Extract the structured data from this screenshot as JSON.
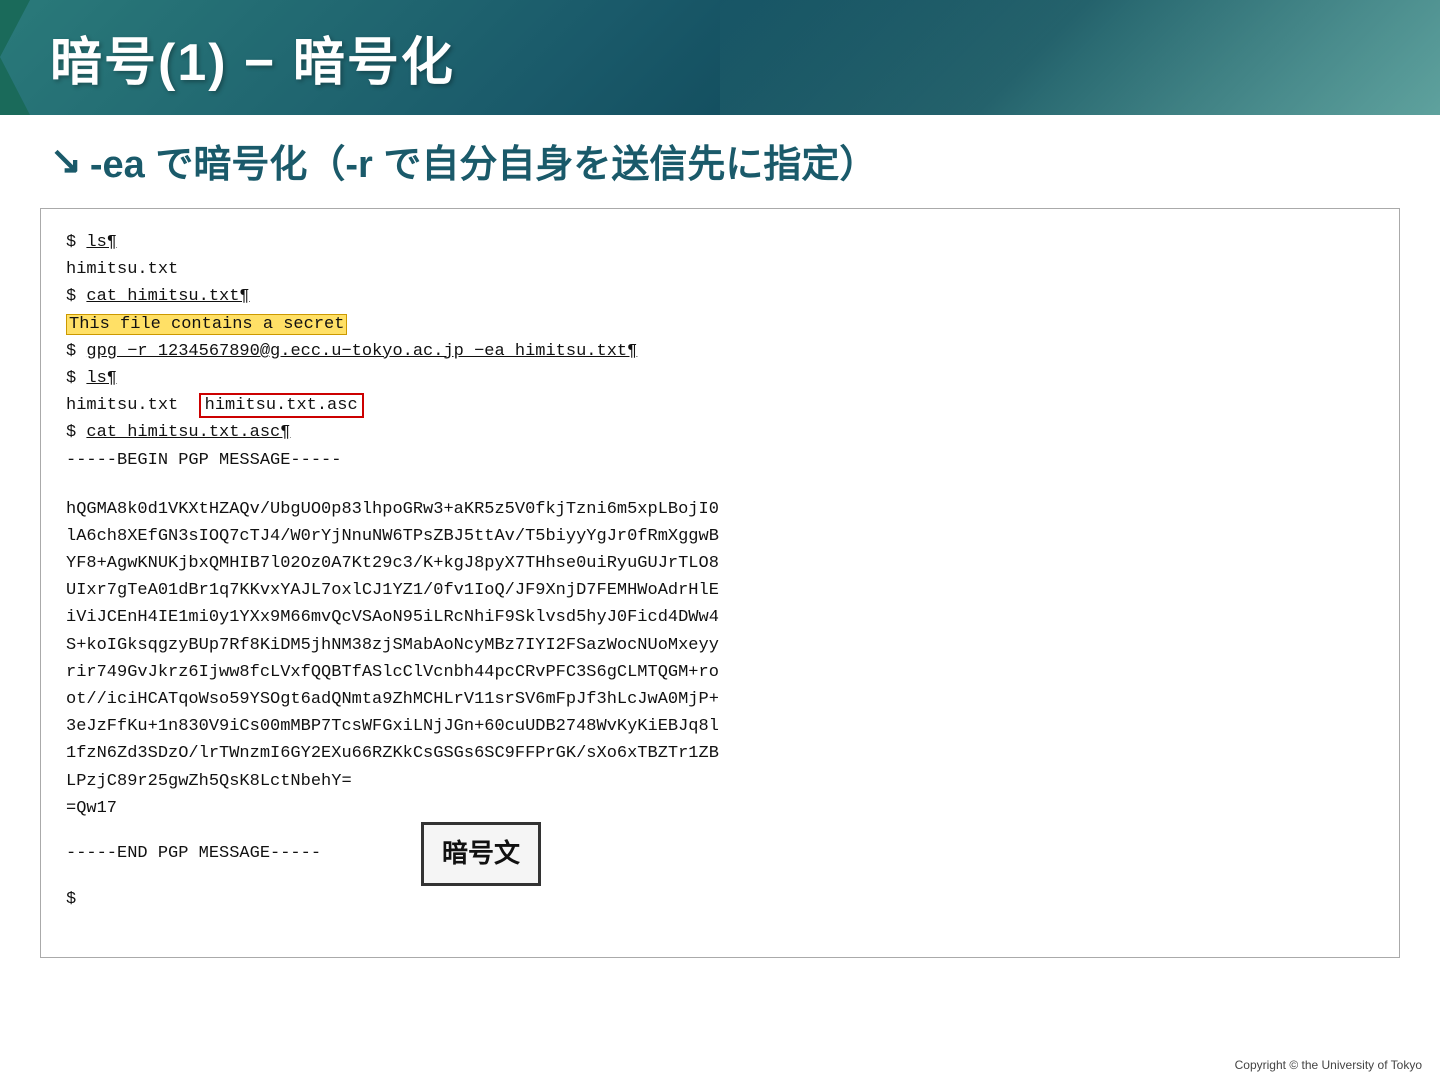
{
  "header": {
    "title": "暗号(1) − 暗号化"
  },
  "subtitle": {
    "arrow": "↘",
    "text": "-ea で暗号化（-r で自分自身を送信先に指定）"
  },
  "terminal": {
    "lines": [
      {
        "type": "prompt",
        "content": "$ ls¶"
      },
      {
        "type": "output",
        "content": "himitsu.txt"
      },
      {
        "type": "prompt-underline",
        "content": "$ cat himitsu.txt¶"
      },
      {
        "type": "output-highlight",
        "content": "This file contains a secret"
      },
      {
        "type": "prompt-underline",
        "content": "$ gpg −r 1234567890@g.ecc.u−tokyo.ac.jp −ea himitsu.txt¶"
      },
      {
        "type": "prompt",
        "content": "$ ls¶"
      },
      {
        "type": "output-box",
        "content": "himitsu.txt",
        "boxed": "himitsu.txt.asc"
      },
      {
        "type": "prompt-underline",
        "content": "$ cat himitsu.txt.asc¶"
      },
      {
        "type": "output",
        "content": "-----BEGIN PGP MESSAGE-----"
      },
      {
        "type": "blank"
      },
      {
        "type": "output",
        "content": "hQGMA8k0d1VKXtHZAQv/UbgUO0p83lhpoGRw3+aKR5z5V0fkjTzni6m5xpLBojI0"
      },
      {
        "type": "output",
        "content": "lA6ch8XEfGN3sIOQ7cTJ4/W0rYjNnuNW6TPsZBJ5ttAv/T5biyyYgJr0fRmXggwB"
      },
      {
        "type": "output",
        "content": "YF8+AgwKNUKjbxQMHIB7l02Oz0A7Kt29c3/K+kgJ8pyX7THhse0uiRyuGUJrTLO8"
      },
      {
        "type": "output",
        "content": "UIxr7gTeA01dBr1q7KKvxYAJL7oxlCJ1YZ1/0fv1IoQ/JF9XnjD7FEMHWoAdrHlE"
      },
      {
        "type": "output",
        "content": "iViJCEnH4IE1mi0y1YXx9M66mvQcVSAoN95iLRcNhiF9Sklvsd5hyJ0Ficd4DWw4"
      },
      {
        "type": "output",
        "content": "S+koIGksqgzyBUp7Rf8KiDM5jhNM38zjSMabAoNcyMBz7IYI2FSazWocNUoMxeyy"
      },
      {
        "type": "output",
        "content": "rir749GvJkrz6Ijww8fcLVxfQQBTfASlcClVcnbh44pcCRvPFC3S6gCLMTQGM+ro"
      },
      {
        "type": "output",
        "content": "ot//iciHCATqoWso59YSOgt6adQNmta9ZhMCHLrV11srSV6mFpJf3hLcJwA0MjP+"
      },
      {
        "type": "output",
        "content": "3eJzFfKu+1n830V9iCs00mMBP7TcsWFGxiLNjJGn+60cuUDB2748WvKyKiEBJq8l"
      },
      {
        "type": "output",
        "content": "1fzN6Zd3SDzO/lrTWnzmI6GY2EXu66RZKkCsGSGs6SC9FFPrGK/sXo6xTBZTr1ZB"
      },
      {
        "type": "output",
        "content": "LPzjC89r25gwZh5QsK8LctNbehY="
      },
      {
        "type": "output",
        "content": "=Qw17"
      },
      {
        "type": "output-with-box",
        "content": "-----END PGP MESSAGE-----",
        "boxLabel": "暗号文"
      },
      {
        "type": "prompt-only",
        "content": "$"
      }
    ]
  },
  "footer": {
    "text": "Copyright © the University of Tokyo"
  }
}
